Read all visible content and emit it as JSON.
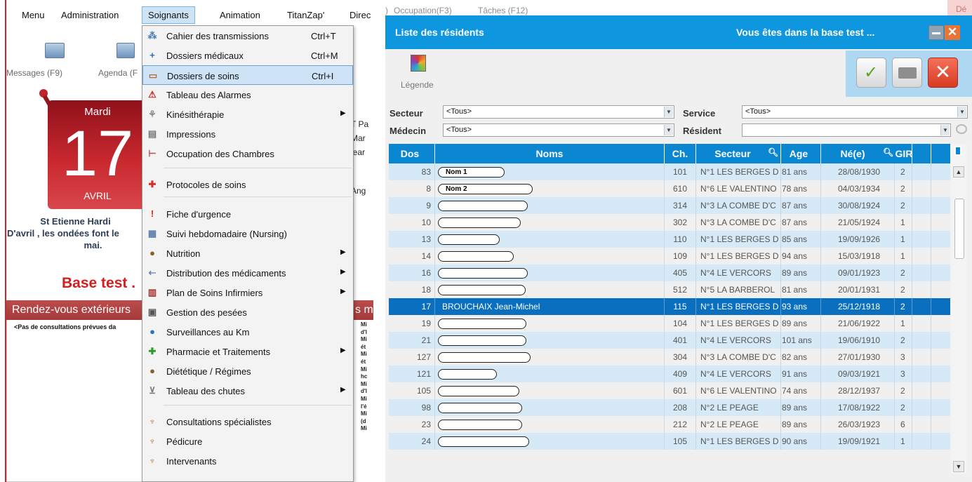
{
  "menubar": {
    "items": [
      "Menu",
      "Administration",
      "Soignants",
      "Animation",
      "TitanZap'",
      "Direc"
    ]
  },
  "toolbar": {
    "messages_label": "Messages (F9)",
    "agenda_label": "Agenda (F"
  },
  "calendar": {
    "day_name": "Mardi",
    "day_number": "17",
    "month": "AVRIL"
  },
  "saint": {
    "line1": "St Etienne Hardi",
    "line2": "D'avril , les ondées font le",
    "line3": "mai."
  },
  "base_test_text": "Base test .",
  "rdv": {
    "header": "Rendez-vous extérieurs",
    "header_suffix": "s m",
    "empty_text": "<Pas de consultations prévues da"
  },
  "right_column": {
    "items": [
      "T Pa",
      "Mar",
      "lear",
      "Ang"
    ]
  },
  "notes_column": [
    "Mi",
    "d'l",
    "Mi",
    "ét",
    "Mi",
    "ét",
    "Mi",
    "hc",
    "Mi",
    "d'l",
    "Mi",
    "l'é",
    "Mi",
    "(d",
    "Mi"
  ],
  "soignants_menu": {
    "items": [
      {
        "label": "Cahier des transmissions",
        "shortcut": "Ctrl+T",
        "icon": "transmissions-icon",
        "glyph": "⁂",
        "color": "#4a7fb5"
      },
      {
        "label": "Dossiers médicaux",
        "shortcut": "Ctrl+M",
        "icon": "medical-folder-icon",
        "glyph": "+",
        "color": "#2b6fb2"
      },
      {
        "label": "Dossiers de soins",
        "shortcut": "Ctrl+I",
        "icon": "care-folder-icon",
        "glyph": "▭",
        "color": "#b26b2b",
        "highlighted": true
      },
      {
        "label": "Tableau des Alarmes",
        "icon": "alarm-icon",
        "glyph": "⚠",
        "color": "#cc2222"
      },
      {
        "label": "Kinésithérapie",
        "submenu": true,
        "icon": "physio-icon",
        "glyph": "⚘",
        "color": "#888888"
      },
      {
        "label": "Impressions",
        "icon": "printer-icon",
        "glyph": "▤",
        "color": "#777777"
      },
      {
        "label": "Occupation des Chambres",
        "icon": "bed-icon",
        "glyph": "⊢",
        "color": "#b05050"
      },
      {
        "label": "Protocoles de soins",
        "icon": "protocol-icon",
        "glyph": "✚",
        "color": "#d62e2e"
      },
      {
        "label": "Fiche d'urgence",
        "icon": "emergency-icon",
        "glyph": "!",
        "color": "#d82020"
      },
      {
        "label": "Suivi hebdomadaire (Nursing)",
        "icon": "weekly-icon",
        "glyph": "▦",
        "color": "#5a7fa8"
      },
      {
        "label": "Nutrition",
        "submenu": true,
        "icon": "nutrition-icon",
        "glyph": "●",
        "color": "#8a5a2a"
      },
      {
        "label": "Distribution des médicaments",
        "submenu": true,
        "icon": "pills-icon",
        "glyph": "⇠",
        "color": "#6a8ab0"
      },
      {
        "label": "Plan de Soins Infirmiers",
        "submenu": true,
        "icon": "nursing-plan-icon",
        "glyph": "▥",
        "color": "#a03030"
      },
      {
        "label": "Gestion des pesées",
        "icon": "scale-icon",
        "glyph": "▣",
        "color": "#555555"
      },
      {
        "label": "Surveillances au Km",
        "icon": "info-icon",
        "glyph": "●",
        "color": "#2a6fc2"
      },
      {
        "label": "Pharmacie et Traitements",
        "submenu": true,
        "icon": "pharmacy-icon",
        "glyph": "✚",
        "color": "#2e9a2e"
      },
      {
        "label": "Diététique / Régimes",
        "icon": "diet-icon",
        "glyph": "●",
        "color": "#8a5a2a"
      },
      {
        "label": "Tableau des chutes",
        "submenu": true,
        "icon": "fall-icon",
        "glyph": "⊻",
        "color": "#7a7a7a"
      },
      {
        "label": "Consultations spécialistes",
        "icon": "specialist-icon",
        "glyph": "♆",
        "color": "#b07030"
      },
      {
        "label": "Pédicure",
        "icon": "pedicure-icon",
        "glyph": "♆",
        "color": "#b07030"
      },
      {
        "label": "Intervenants",
        "icon": "intervenants-icon",
        "glyph": "♆",
        "color": "#b07030"
      }
    ]
  },
  "top_strip": {
    "occupation": "Occupation(F3)",
    "taches": "Tâches (F12)",
    "prefix": ")",
    "right_stub": "Dé"
  },
  "residents_window": {
    "title": "Liste des résidents",
    "subtitle": "Vous êtes dans la base test ...",
    "legend_label": "Légende",
    "filters": {
      "secteur_label": "Secteur",
      "secteur_value": "<Tous>",
      "service_label": "Service",
      "service_value": "<Tous>",
      "medecin_label": "Médecin",
      "medecin_value": "<Tous>",
      "resident_label": "Résident",
      "resident_value": ""
    },
    "columns": [
      "Dos",
      "Noms",
      "Ch.",
      "Secteur",
      "Age",
      "Né(e)",
      "GIR"
    ],
    "rows": [
      {
        "dos": "83",
        "name": "Nom 1",
        "pill": 95,
        "ch": "101",
        "secteur": "N°1 LES BERGES D",
        "age": "81 ans",
        "dob": "28/08/1930",
        "gir": "2"
      },
      {
        "dos": "8",
        "name": "Nom 2",
        "pill": 135,
        "ch": "610",
        "secteur": "N°6 LE VALENTINO",
        "age": "78 ans",
        "dob": "04/03/1934",
        "gir": "2"
      },
      {
        "dos": "9",
        "name": "",
        "pill": 128,
        "ch": "314",
        "secteur": "N°3 LA COMBE D'C",
        "age": "87 ans",
        "dob": "30/08/1924",
        "gir": "2"
      },
      {
        "dos": "10",
        "name": "",
        "pill": 118,
        "ch": "302",
        "secteur": "N°3 LA COMBE D'C",
        "age": "87 ans",
        "dob": "21/05/1924",
        "gir": "1"
      },
      {
        "dos": "13",
        "name": "",
        "pill": 88,
        "ch": "110",
        "secteur": "N°1 LES BERGES D",
        "age": "85 ans",
        "dob": "19/09/1926",
        "gir": "1"
      },
      {
        "dos": "14",
        "name": "",
        "pill": 108,
        "ch": "109",
        "secteur": "N°1 LES BERGES D",
        "age": "94 ans",
        "dob": "15/03/1918",
        "gir": "1"
      },
      {
        "dos": "16",
        "name": "",
        "pill": 128,
        "ch": "405",
        "secteur": "N°4 LE VERCORS",
        "age": "89 ans",
        "dob": "09/01/1923",
        "gir": "2"
      },
      {
        "dos": "18",
        "name": "",
        "pill": 125,
        "ch": "512",
        "secteur": "N°5 LA BARBEROL",
        "age": "81 ans",
        "dob": "20/01/1931",
        "gir": "2"
      },
      {
        "dos": "17",
        "name": "BROUCHAIX Jean-Michel",
        "pill": 0,
        "ch": "115",
        "secteur": "N°1 LES BERGES D",
        "age": "93 ans",
        "dob": "25/12/1918",
        "gir": "2",
        "selected": true
      },
      {
        "dos": "19",
        "name": "",
        "pill": 126,
        "ch": "104",
        "secteur": "N°1 LES BERGES D",
        "age": "89 ans",
        "dob": "21/06/1922",
        "gir": "1"
      },
      {
        "dos": "21",
        "name": "",
        "pill": 126,
        "ch": "401",
        "secteur": "N°4 LE VERCORS",
        "age": "101 ans",
        "dob": "19/06/1910",
        "gir": "2"
      },
      {
        "dos": "127",
        "name": "",
        "pill": 132,
        "ch": "304",
        "secteur": "N°3 LA COMBE D'C",
        "age": "82 ans",
        "dob": "27/01/1930",
        "gir": "3"
      },
      {
        "dos": "121",
        "name": "",
        "pill": 84,
        "ch": "409",
        "secteur": "N°4 LE VERCORS",
        "age": "91 ans",
        "dob": "09/03/1921",
        "gir": "3"
      },
      {
        "dos": "105",
        "name": "",
        "pill": 116,
        "ch": "601",
        "secteur": "N°6 LE VALENTINO",
        "age": "74 ans",
        "dob": "28/12/1937",
        "gir": "2"
      },
      {
        "dos": "98",
        "name": "",
        "pill": 120,
        "ch": "208",
        "secteur": "N°2 LE PEAGE",
        "age": "89 ans",
        "dob": "17/08/1922",
        "gir": "2"
      },
      {
        "dos": "23",
        "name": "",
        "pill": 120,
        "ch": "212",
        "secteur": "N°2 LE PEAGE",
        "age": "89 ans",
        "dob": "26/03/1923",
        "gir": "6"
      },
      {
        "dos": "24",
        "name": "",
        "pill": 130,
        "ch": "105",
        "secteur": "N°1 LES BERGES D",
        "age": "90 ans",
        "dob": "19/09/1921",
        "gir": "1"
      }
    ]
  }
}
